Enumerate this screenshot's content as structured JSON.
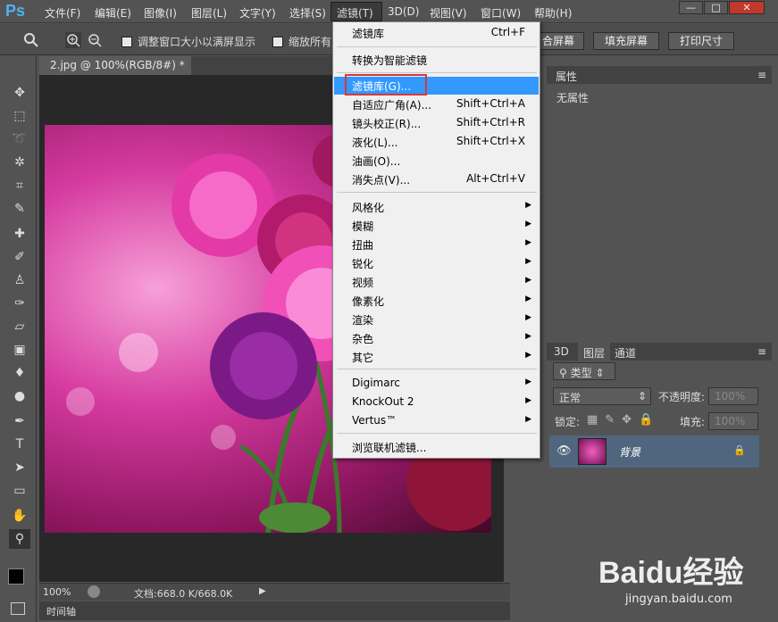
{
  "menubar": {
    "logo": "Ps",
    "items": [
      "文件(F)",
      "编辑(E)",
      "图像(I)",
      "图层(L)",
      "文字(Y)",
      "选择(S)",
      "滤镜(T)",
      "3D(D)",
      "视图(V)",
      "窗口(W)",
      "帮助(H)"
    ],
    "window_buttons": [
      "—",
      "□",
      "✕"
    ]
  },
  "options": {
    "chk1": "调整窗口大小以满屏显示",
    "chk2": "缩放所有",
    "btn_fit": "合屏幕",
    "btn_fill": "填充屏幕",
    "btn_print": "打印尺寸"
  },
  "document": {
    "tab_title": "2.jpg @ 100%(RGB/8#) *",
    "zoom": "100%",
    "file_info": "文档:668.0 K/668.0K",
    "timeline": "时间轴"
  },
  "properties": {
    "tab": "属性",
    "content": "无属性"
  },
  "layers": {
    "tabs": [
      "3D",
      "图层",
      "通道"
    ],
    "filter_kind": "类型",
    "blend_mode": "正常",
    "opacity_label": "不透明度:",
    "opacity_value": "100%",
    "lock_label": "锁定:",
    "fill_label": "填充:",
    "fill_value": "100%",
    "layer_name": "背景"
  },
  "filter_menu": {
    "last_filter": "滤镜库",
    "last_filter_sc": "Ctrl+F",
    "smart": "转换为智能滤镜",
    "items1": [
      {
        "label": "滤镜库(G)...",
        "sc": ""
      },
      {
        "label": "自适应广角(A)...",
        "sc": "Shift+Ctrl+A"
      },
      {
        "label": "镜头校正(R)...",
        "sc": "Shift+Ctrl+R"
      },
      {
        "label": "液化(L)...",
        "sc": "Shift+Ctrl+X"
      },
      {
        "label": "油画(O)...",
        "sc": ""
      },
      {
        "label": "消失点(V)...",
        "sc": "Alt+Ctrl+V"
      }
    ],
    "items2": [
      "风格化",
      "模糊",
      "扭曲",
      "锐化",
      "视频",
      "像素化",
      "渲染",
      "杂色",
      "其它"
    ],
    "items3": [
      "Digimarc",
      "KnockOut 2",
      "Vertus™"
    ],
    "browse": "浏览联机滤镜..."
  },
  "watermark": {
    "brand": "Baidu经验",
    "url": "jingyan.baidu.com"
  }
}
